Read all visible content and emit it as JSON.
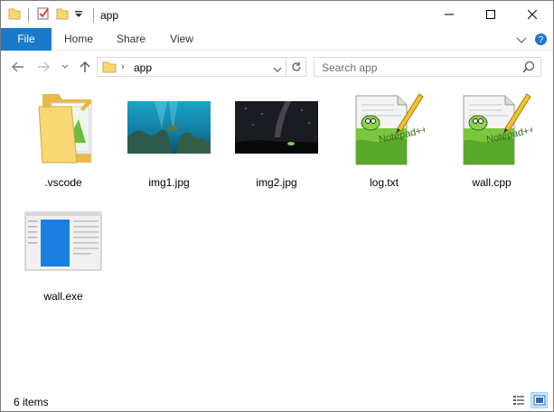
{
  "window": {
    "title": "app"
  },
  "ribbon": {
    "tabs": [
      "File",
      "Home",
      "Share",
      "View"
    ]
  },
  "address": {
    "path": "app",
    "search_placeholder": "Search app"
  },
  "items": [
    {
      "name": ".vscode",
      "kind": "folder"
    },
    {
      "name": "img1.jpg",
      "kind": "image-underwater"
    },
    {
      "name": "img2.jpg",
      "kind": "image-night-sky"
    },
    {
      "name": "log.txt",
      "kind": "notepad-plus-plus-icon"
    },
    {
      "name": "wall.cpp",
      "kind": "notepad-plus-plus-icon"
    },
    {
      "name": "wall.exe",
      "kind": "executable"
    }
  ],
  "status": {
    "item_count": "6 items"
  },
  "colors": {
    "file_tab": "#1979ca",
    "folder": "#f8d775",
    "selected_view": "#cce8ff"
  }
}
